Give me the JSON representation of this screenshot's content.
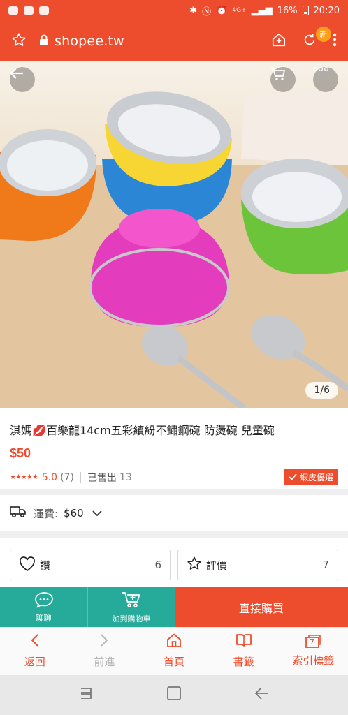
{
  "status": {
    "network": "4G+",
    "battery": "16%",
    "time": "20:20"
  },
  "browser": {
    "url": "shopee.tw",
    "new_badge": "新"
  },
  "gallery": {
    "counter": "1/6"
  },
  "product": {
    "title_prefix": "淇媽",
    "title_main": "百樂龍14cm五彩繽紛不鏽鋼碗 防燙碗 兒童碗",
    "price": "$50",
    "stars": "★★★★★",
    "rating": "5.0",
    "rating_count": "(7)",
    "sold_label": "已售出",
    "sold_count": "13",
    "preferred_label": "蝦皮優選"
  },
  "shipping": {
    "label": "運費:",
    "value": "$60"
  },
  "actions": {
    "like_label": "讚",
    "like_count": "6",
    "review_label": "評價",
    "review_count": "7"
  },
  "buy_bar": {
    "chat_label": "聊聊",
    "cart_label": "加到購物車",
    "buy_label": "直接購買"
  },
  "browser_nav": {
    "back": "返回",
    "forward": "前進",
    "home": "首頁",
    "bookmarks": "書籤",
    "tabs": "索引標籤",
    "tab_count": "7"
  },
  "colors": {
    "brand": "#ee4d2d",
    "teal": "#26aa99"
  }
}
